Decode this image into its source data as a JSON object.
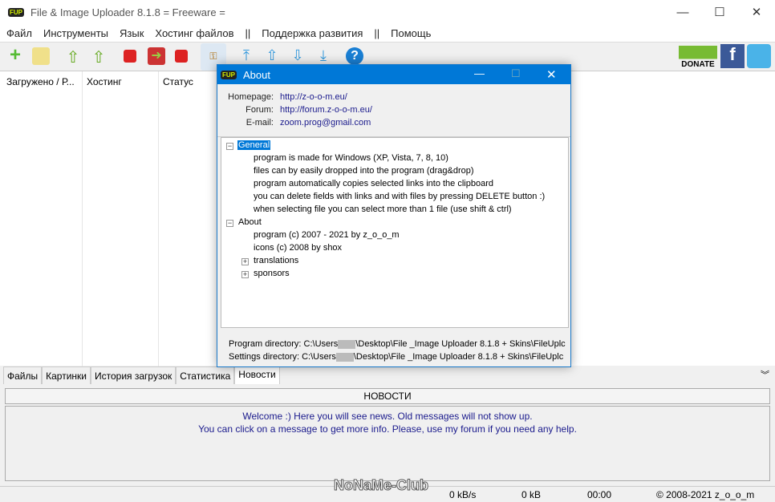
{
  "window": {
    "title": "File & Image Uploader 8.1.8  = Freeware =",
    "logo": "FUP"
  },
  "menu": [
    "Файл",
    "Инструменты",
    "Язык",
    "Хостинг файлов",
    "||",
    "Поддержка развития",
    "||",
    "Помощь"
  ],
  "toolbar": {
    "donate": "DONATE"
  },
  "list": {
    "columns": [
      "Загружено / Р...",
      "Хостинг",
      "Статус"
    ]
  },
  "tabs": [
    "Файлы",
    "Картинки",
    "История загрузок",
    "Статистика",
    "Новости"
  ],
  "news": {
    "header": "НОВОСТИ",
    "line1": "Welcome :) Here you will see news. Old messages will not show up.",
    "line2": "You can click on a message to get more info. Please, use my forum if you need any help."
  },
  "status": {
    "watermark": "NoNaMe-Club",
    "speed": "0 kB/s",
    "size": "0 kB",
    "time": "00:00",
    "copyright": "© 2008-2021 z_o_o_m"
  },
  "about": {
    "title": "About",
    "homepage_label": "Homepage:",
    "homepage": "http://z-o-o-m.eu/",
    "forum_label": "Forum:",
    "forum": "http://forum.z-o-o-m.eu/",
    "email_label": "E-mail:",
    "email": "zoom.prog@gmail.com",
    "tree": {
      "general": "General",
      "general_items": [
        "program is made for Windows (XP, Vista, 7, 8, 10)",
        "files can by easily dropped into the program (drag&drop)",
        "program automatically copies selected links into the clipboard",
        "you can delete fields with links and with files by pressing DELETE button :)",
        "when selecting file you can select more than 1 file (use shift & ctrl)"
      ],
      "about": "About",
      "about_items": [
        "program (c) 2007 - 2021 by z_o_o_m",
        "icons (c) 2008 by shox",
        "translations",
        "sponsors"
      ]
    },
    "program_dir_label": "Program directory: C:\\Users",
    "program_dir_rest": "\\Desktop\\File _Image Uploader 8.1.8 + Skins\\FileUplc",
    "settings_dir_label": "Settings directory: C:\\Users",
    "settings_dir_rest": "\\Desktop\\File _Image Uploader 8.1.8 + Skins\\FileUplc"
  }
}
